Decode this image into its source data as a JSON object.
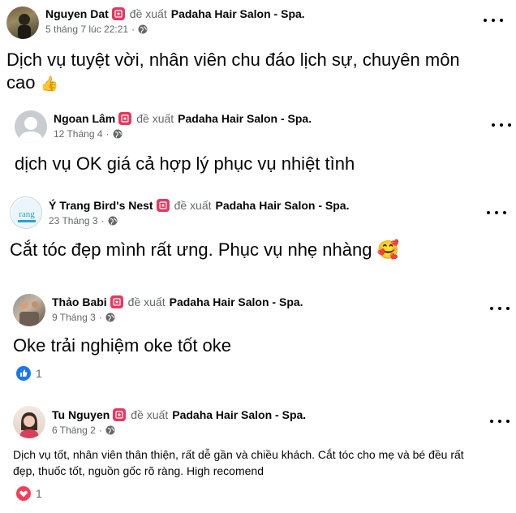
{
  "reviews": [
    {
      "author": "Nguyen Dat",
      "verb": "đề xuất",
      "page": "Padaha Hair Salon - Spa",
      "date": "5 tháng 7 lúc 22:21",
      "dot": "·",
      "text_line1": "Dịch vụ tuyệt vời, nhân viên chu đáo lịch sự, chuyên môn",
      "text_line2": "cao",
      "emoji": "👍"
    },
    {
      "author": "Ngoan Lâm",
      "verb": "đề xuất",
      "page": "Padaha Hair Salon - Spa",
      "date": "12 Tháng 4",
      "dot": "·",
      "text": "dịch vụ OK giá cả hợp lý phục vụ nhiệt tình"
    },
    {
      "author": "Ý Trang Bird's Nest",
      "verb": "đề xuất",
      "page": "Padaha Hair Salon - Spa",
      "date": "23 Tháng 3",
      "dot": "·",
      "text": "Cắt tóc đẹp mình rất ưng. Phục vụ nhẹ nhàng",
      "emoji": "🥰",
      "avatar_text": "rang"
    },
    {
      "author": "Thảo Babi",
      "verb": "đề xuất",
      "page": "Padaha Hair Salon - Spa",
      "date": "9 Tháng 3",
      "dot": "·",
      "text": "Oke trải nghiệm oke tốt oke",
      "reaction_count": "1",
      "reaction_type": "like-icon"
    },
    {
      "author": "Tu Nguyen",
      "verb": "đề xuất",
      "page": "Padaha Hair Salon - Spa",
      "date": "6 Tháng 2",
      "dot": "·",
      "text_line1": "Dịch vụ tốt, nhân viên thân thiện, rất dễ gần và chiều khách. Cắt tóc cho mẹ và bé đều rất",
      "text_line2": "đẹp, thuốc tốt, nguồn gốc rõ ràng. High recomend",
      "reaction_count": "1",
      "reaction_type": "love-icon"
    }
  ],
  "colors": {
    "recommend": "#e8365d",
    "like": "#1877f2",
    "love": "#f33e58",
    "secondary_text": "#65676b"
  }
}
